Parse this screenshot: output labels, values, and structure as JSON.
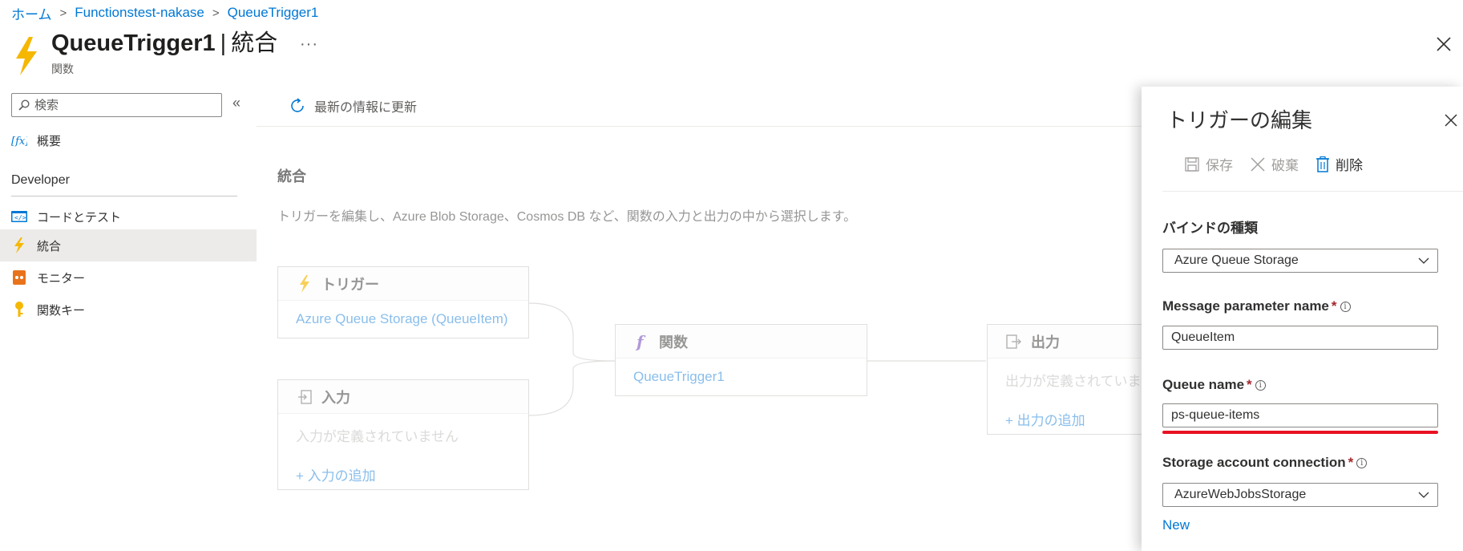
{
  "breadcrumb": {
    "home": "ホーム",
    "app": "Functionstest-nakase",
    "function": "QueueTrigger1"
  },
  "header": {
    "title": "QueueTrigger1",
    "separator": "|",
    "section": "統合",
    "subtitle": "関数",
    "more": "···"
  },
  "sidebar": {
    "search_placeholder": "検索",
    "collapse": "«",
    "overview": "概要",
    "section": "Developer",
    "items": [
      {
        "label": "コードとテスト",
        "icon": "code-icon"
      },
      {
        "label": "統合",
        "icon": "bolt-icon",
        "active": true
      },
      {
        "label": "モニター",
        "icon": "monitor-icon"
      },
      {
        "label": "関数キー",
        "icon": "key-icon"
      }
    ]
  },
  "toolbar": {
    "refresh": "最新の情報に更新"
  },
  "main": {
    "title": "統合",
    "description": "トリガーを編集し、Azure Blob Storage、Cosmos DB など、関数の入力と出力の中から選択します。",
    "trigger": {
      "title": "トリガー",
      "value": "Azure Queue Storage (QueueItem)"
    },
    "input": {
      "title": "入力",
      "empty": "入力が定義されていません",
      "add": "+ 入力の追加"
    },
    "function": {
      "title": "関数",
      "name": "QueueTrigger1"
    },
    "output": {
      "title": "出力",
      "empty": "出力が定義されていま",
      "add": "+ 出力の追加"
    }
  },
  "panel": {
    "title": "トリガーの編集",
    "save": "保存",
    "discard": "破棄",
    "delete": "削除",
    "binding_type_label": "バインドの種類",
    "binding_type_value": "Azure Queue Storage",
    "msg_param_label": "Message parameter name",
    "msg_param_value": "QueueItem",
    "queue_name_label": "Queue name",
    "queue_name_value": "ps-queue-items",
    "storage_label": "Storage account connection",
    "storage_value": "AzureWebJobsStorage",
    "required_mark": "*",
    "info_mark": "i",
    "new_link": "New"
  },
  "colors": {
    "accent": "#0078d4",
    "bolt": "#f5b700",
    "highlight": "#e81123"
  }
}
